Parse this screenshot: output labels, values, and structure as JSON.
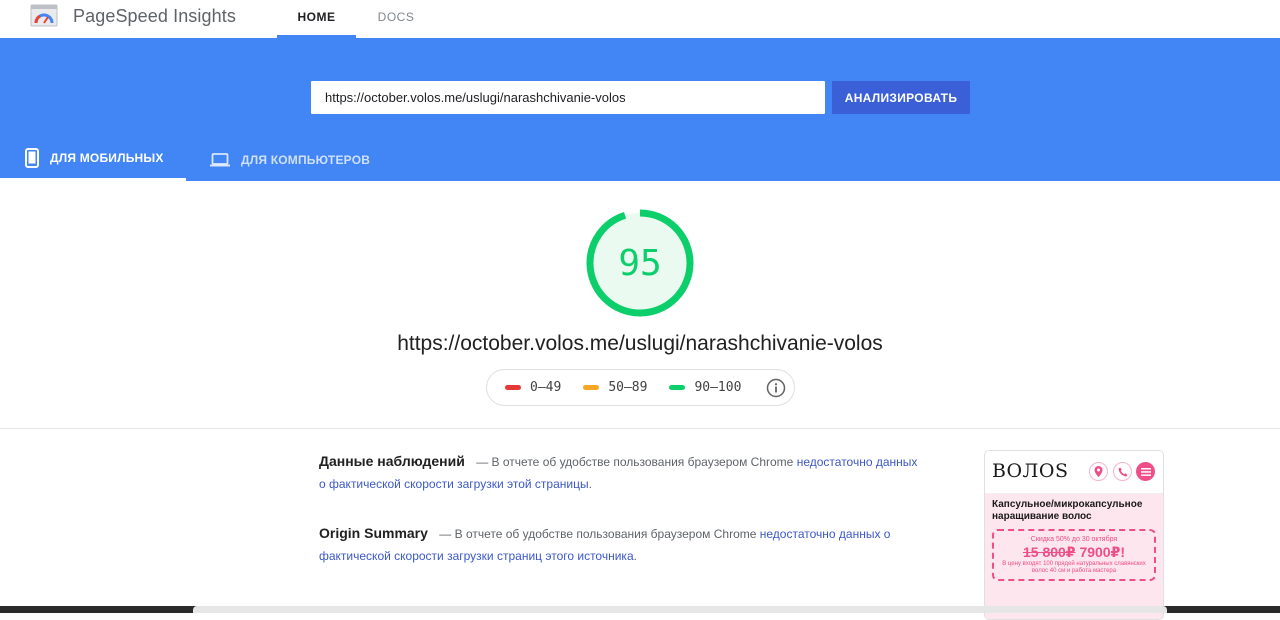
{
  "header": {
    "app_title": "PageSpeed Insights",
    "tabs": [
      {
        "label": "HOME",
        "active": true
      },
      {
        "label": "DOCS",
        "active": false
      }
    ]
  },
  "search": {
    "url_value": "https://october.volos.me/uslugi/narashchivanie-volos",
    "analyze_label": "АНАЛИЗИРОВАТЬ"
  },
  "device_tabs": [
    {
      "label": "ДЛЯ МОБИЛЬНЫХ",
      "icon": "smartphone-icon",
      "active": true
    },
    {
      "label": "ДЛЯ КОМПЬЮТЕРОВ",
      "icon": "laptop-icon",
      "active": false
    }
  ],
  "score": {
    "value": 95,
    "fraction": 0.95,
    "color": "#0cce6b",
    "tested_url": "https://october.volos.me/uslugi/narashchivanie-volos"
  },
  "legend": [
    {
      "range": "0–49",
      "color": "#e53935"
    },
    {
      "range": "50–89",
      "color": "#f5a623"
    },
    {
      "range": "90–100",
      "color": "#0cce6b"
    }
  ],
  "field_data": {
    "title": "Данные наблюдений",
    "dash": "—",
    "text": "В отчете об удобстве пользования браузером Chrome",
    "link": "недостаточно данных о фактической скорости загрузки этой страницы",
    "tail": "."
  },
  "origin_summary": {
    "title": "Origin Summary",
    "dash": "—",
    "text": "В отчете об удобстве пользования браузером Chrome",
    "link": "недостаточно данных о фактической скорости загрузки страниц этого источника",
    "tail": "."
  },
  "thumbnail": {
    "brand": "ВОЛОS",
    "heading": "Капсульное/микрокапсульное наращивание волос",
    "promo_sub": "Скидка 50% до 30 октября",
    "old_price": "15 800₽",
    "new_price": "7900₽!",
    "promo_note": "В цену входят 100 прядей натуральных славянских волос 40 см и работа мастера"
  },
  "colors": {
    "accent": "#4285f4",
    "button": "#3b5fd6",
    "link": "#3c58c8"
  }
}
